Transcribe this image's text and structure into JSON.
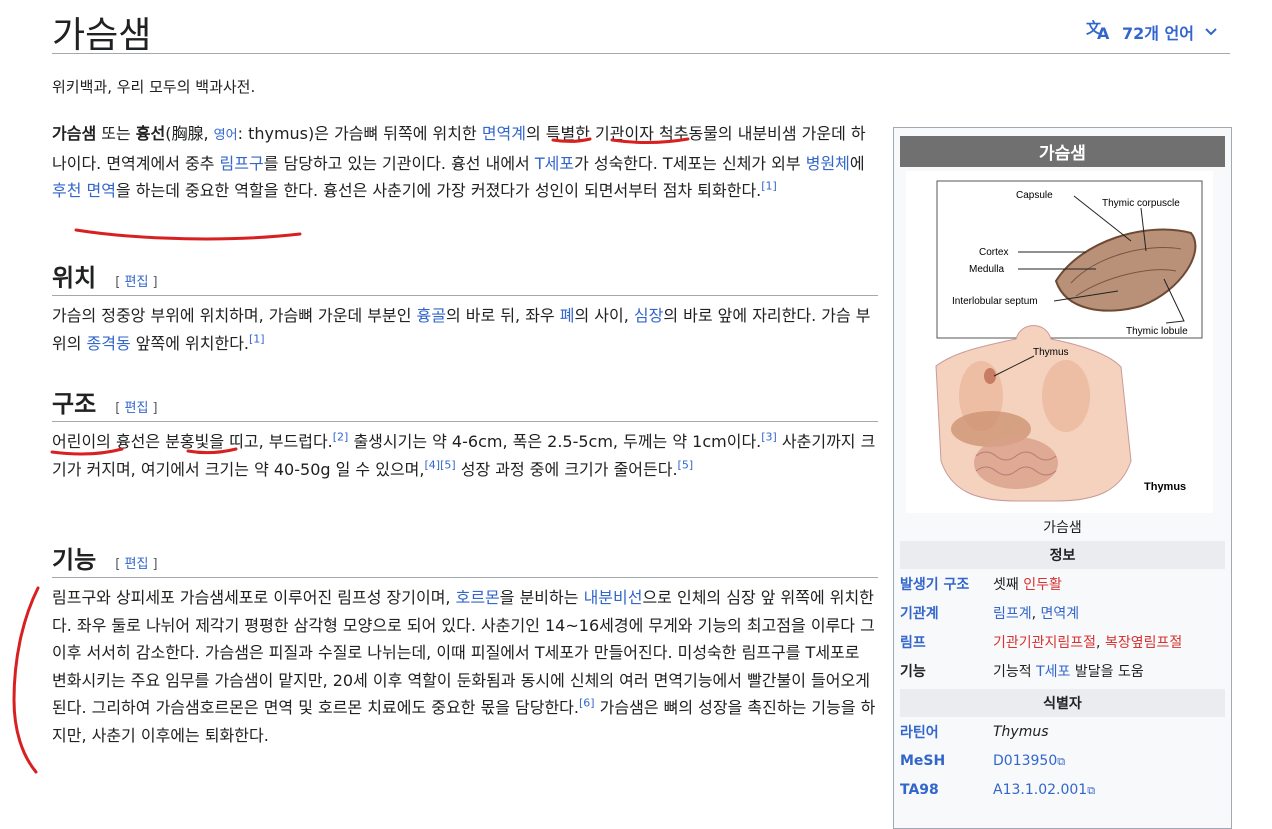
{
  "page": {
    "title": "가슴샘",
    "languages": "72개 언어",
    "tagline": "위키백과, 우리 모두의 백과사전."
  },
  "intro": {
    "b1": "가슴샘",
    "t1": " 또는 ",
    "b2": "흉선",
    "t2": "(胸腺, ",
    "l_lang": "영어",
    "t3": ": thymus)은 가슴뼈 뒤쪽에 위치한 ",
    "l1": "면역계",
    "t4": "의 특별한 기관이자 척추동물의 내분비샘 가운데 하나이다. 면역계에서 중추 ",
    "l2": "림프구",
    "t5": "를 담당하고 있는 기관이다. 흉선 내에서 ",
    "l3": "T세포",
    "t6": "가 성숙한다. T세포는 신체가 외부 ",
    "l4": "병원체",
    "t7": "에 ",
    "l5": "후천 면역",
    "t8": "을 하는데 중요한 역할을 한다. 흉선은 사춘기에 가장 커졌다가 성인이 되면서부터 점차 퇴화한다.",
    "ref": "[1]"
  },
  "sections": {
    "edit_label": "편집",
    "s1": {
      "heading": "위치",
      "t1": "가슴의 정중앙 부위에 위치하며, 가슴뼈 가운데 부분인 ",
      "l1": "흉골",
      "t2": "의 바로 뒤, 좌우 ",
      "l2": "폐",
      "t3": "의 사이, ",
      "l3": "심장",
      "t4": "의 바로 앞에 자리한다. 가슴 부위의 ",
      "l4": "종격동",
      "t5": " 앞쪽에 위치한다.",
      "ref": "[1]"
    },
    "s2": {
      "heading": "구조",
      "t1": "어린이의 흉선은 분홍빛을 띠고, 부드럽다.",
      "r1": "[2]",
      "t2": " 출생시기는 약 4-6cm, 폭은 2.5-5cm, 두께는 약 1cm이다.",
      "r2": "[3]",
      "t3": " 사춘기까지 크기가 커지며, 여기에서 크기는 약 40-50g 일 수 있으며,",
      "r3": "[4]",
      "r4": "[5]",
      "t4": " 성장 과정 중에 크기가 줄어든다.",
      "r5": "[5]"
    },
    "s3": {
      "heading": "기능",
      "t1": "림프구와 상피세포 가슴샘세포로 이루어진 림프성 장기이며, ",
      "l1": "호르몬",
      "t2": "을 분비하는 ",
      "l2": "내분비선",
      "t3": "으로 인체의 심장 앞 위쪽에 위치한다. 좌우 둘로 나뉘어 제각기 평평한 삼각형 모양으로 되어 있다. 사춘기인 14~16세경에 무게와 기능의 최고점을 이루다 그 이후 서서히 감소한다. 가슴샘은 피질과 수질로 나뉘는데, 이때 피질에서 T세포가 만들어진다. 미성숙한 림프구를 T세포로 변화시키는 주요 임무를 가슴샘이 맡지만, 20세 이후 역할이 둔화됨과 동시에 신체의 여러 면역기능에서 빨간불이 들어오게 된다. 그리하여 가슴샘호르몬은 면역 및 호르몬 치료에도 중요한 몫을 담당한다.",
      "r1": "[6]",
      "t4": " 가슴샘은 뼈의 성장을 촉진하는 기능을 하지만, 사춘기 이후에는 퇴화한다."
    }
  },
  "infobox": {
    "title": "가슴샘",
    "image_labels": {
      "capsule": "Capsule",
      "corpuscle": "Thymic corpuscle",
      "cortex": "Cortex",
      "medulla": "Medulla",
      "septum": "Interlobular septum",
      "lobule": "Thymic lobule",
      "thymus": "Thymus",
      "thymus_bold": "Thymus"
    },
    "caption": "가슴샘",
    "band_info": "정보",
    "rows": [
      {
        "key": "발생기 구조",
        "v1": "셋째 ",
        "v2": "인두활"
      },
      {
        "key": "기관계",
        "v1": "림프계",
        "v2": ", ",
        "v3": "면역계"
      },
      {
        "key": "림프",
        "v1": "기관기관지림프절",
        "v2": ", ",
        "v3": "복장옆림프절"
      },
      {
        "key": "기능",
        "v1": "기능적 ",
        "v2": "T세포",
        "v3": " 발달을 도움"
      }
    ],
    "band_ids": "식별자",
    "ids": [
      {
        "key": "라틴어",
        "value": "Thymus"
      },
      {
        "key": "MeSH",
        "value": "D013950"
      },
      {
        "key": "TA98",
        "value": "A13.1.02.001"
      }
    ]
  },
  "colors": {
    "link": "#3366cc",
    "redlink": "#d73333",
    "annotation": "#d92020"
  }
}
